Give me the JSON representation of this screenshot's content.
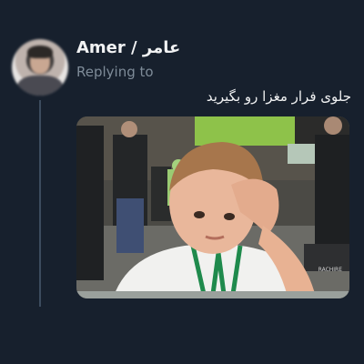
{
  "tweet": {
    "author_name": "Amer / عامر",
    "replying_label": "Replying to",
    "text": "جلوی فرار مغزا رو بگیرید"
  },
  "media": {
    "watermark": "RACHIRE"
  },
  "icons": {
    "avatar": "profile-photo"
  },
  "colors": {
    "background": "#17202d",
    "muted_text": "#7e8b98",
    "thread_line": "#3c4b5e"
  }
}
